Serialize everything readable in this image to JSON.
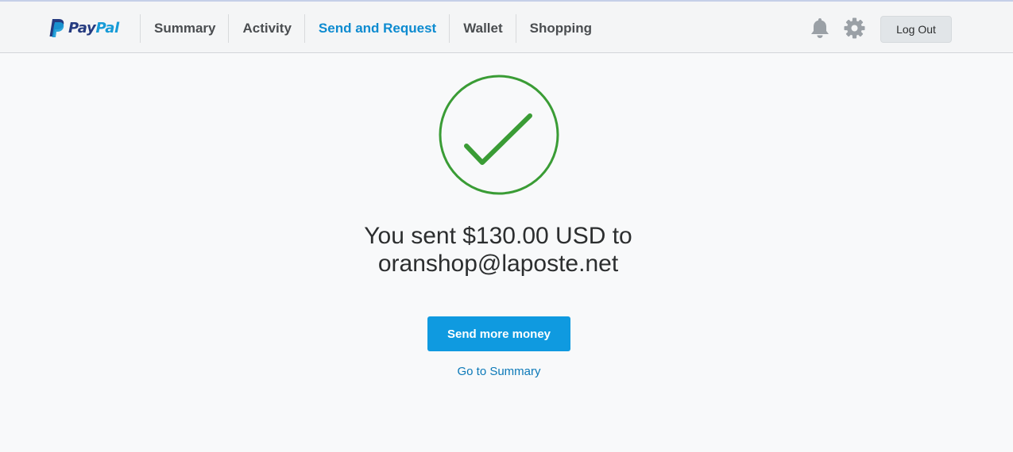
{
  "header": {
    "logo": {
      "pay": "Pay",
      "pal": "Pal",
      "icon": "paypal-p-icon"
    },
    "nav": [
      {
        "label": "Summary",
        "active": false
      },
      {
        "label": "Activity",
        "active": false
      },
      {
        "label": "Send and Request",
        "active": true
      },
      {
        "label": "Wallet",
        "active": false
      },
      {
        "label": "Shopping",
        "active": false
      }
    ],
    "icons": [
      "bell-icon",
      "gear-icon"
    ],
    "logout_label": "Log Out"
  },
  "confirmation": {
    "icon": "checkmark-circle-icon",
    "line1": "You sent $130.00 USD to",
    "line2": "oranshop@laposte.net",
    "send_more_label": "Send more money",
    "summary_link": "Go to Summary"
  },
  "colors": {
    "accent": "#0f9ae0",
    "active_nav": "#0d8bd0",
    "success": "#3a9c35",
    "link": "#0c79b8"
  }
}
